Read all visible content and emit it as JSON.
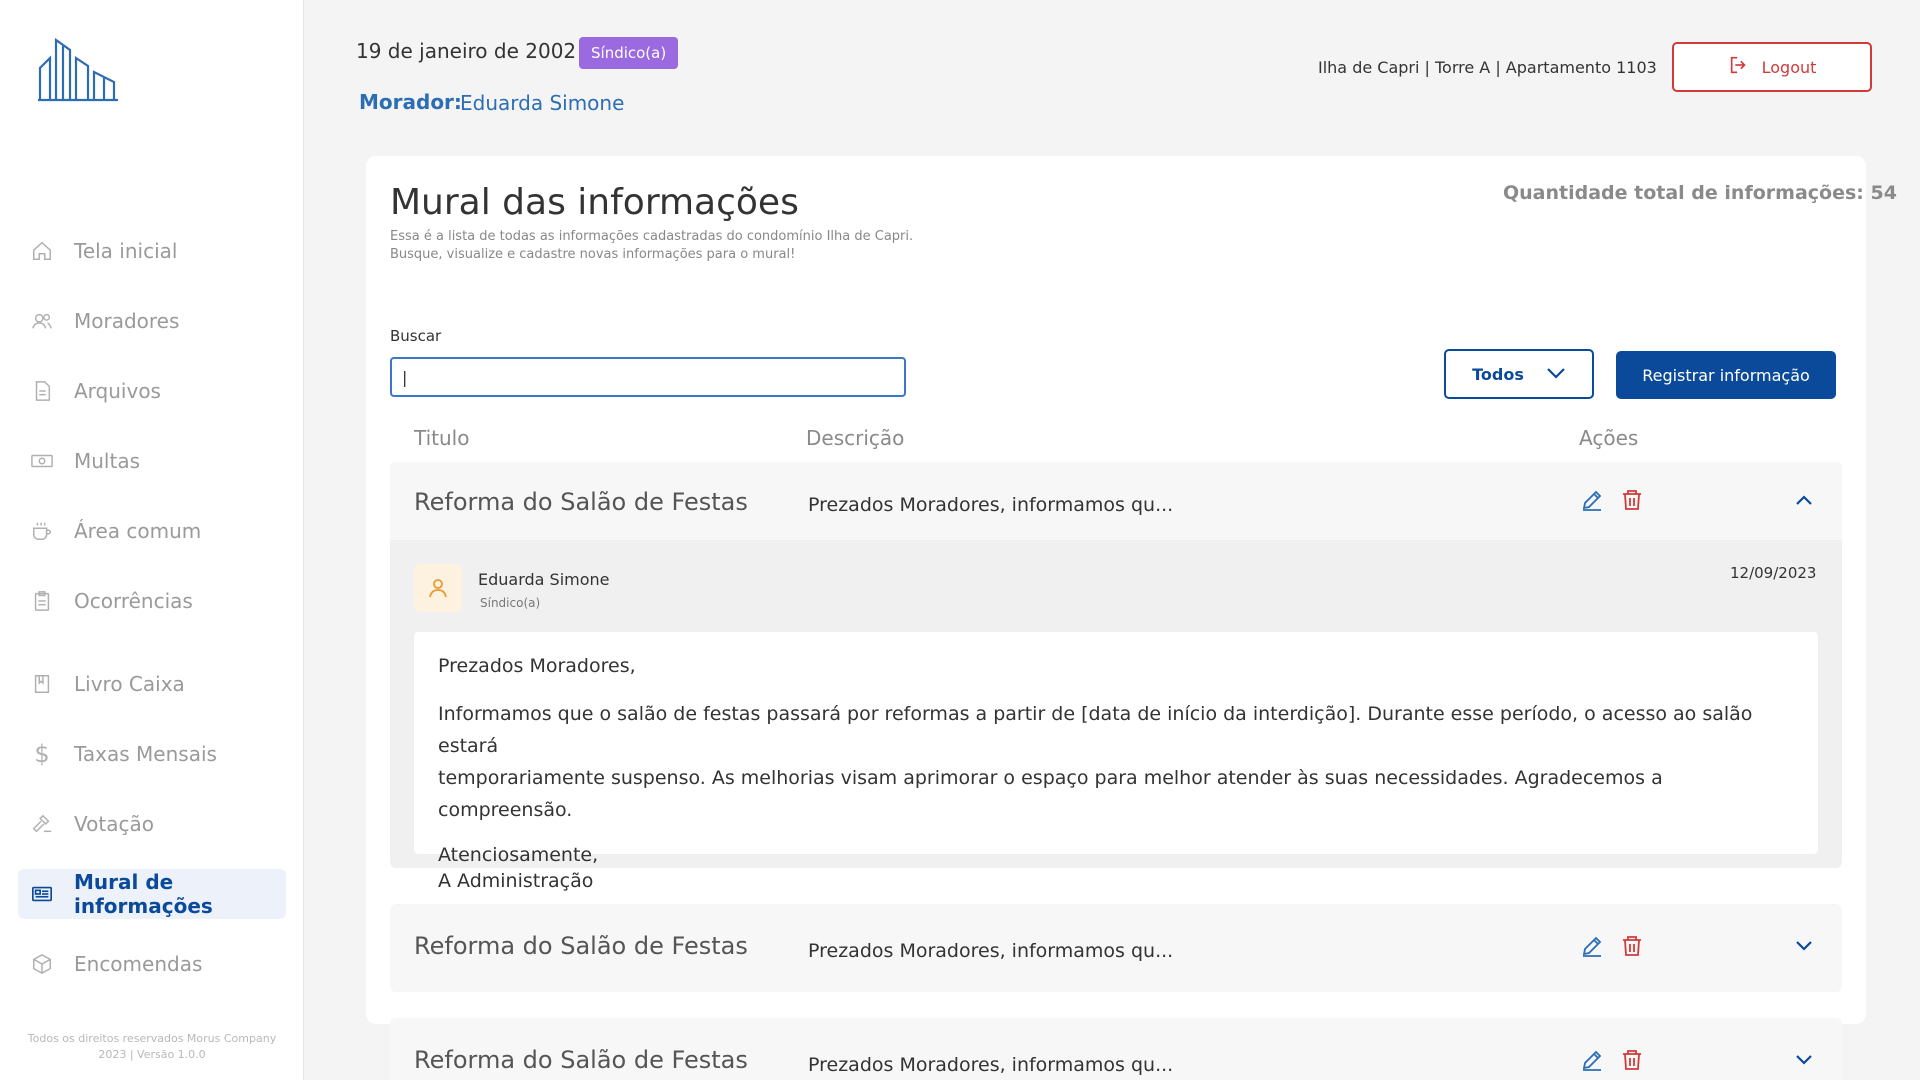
{
  "sidebar": {
    "items": [
      {
        "label": "Tela inicial",
        "icon": "home-icon"
      },
      {
        "label": "Moradores",
        "icon": "users-icon"
      },
      {
        "label": "Arquivos",
        "icon": "file-icon"
      },
      {
        "label": "Multas",
        "icon": "money-icon"
      },
      {
        "label": "Área comum",
        "icon": "coffee-icon"
      },
      {
        "label": "Ocorrências",
        "icon": "clipboard-icon"
      },
      {
        "label": "Livro Caixa",
        "icon": "book-icon"
      },
      {
        "label": "Taxas Mensais",
        "icon": "dollar-icon"
      },
      {
        "label": "Votação",
        "icon": "gavel-icon"
      },
      {
        "label": "Mural de informações",
        "icon": "newspaper-icon",
        "active": true
      },
      {
        "label": "Encomendas",
        "icon": "package-icon"
      }
    ],
    "footer_line1": "Todos os direitos reservados Morus Company",
    "footer_line2": "2023 | Versão 1.0.0"
  },
  "header": {
    "date": "19 de janeiro de 2002",
    "role_badge": "Síndico(a)",
    "morador_label": "Morador:",
    "morador_name": "Eduarda Simone",
    "unit_info": "Ilha de Capri | Torre A | Apartamento 1103",
    "logout_label": "Logout"
  },
  "main": {
    "title": "Mural das informações",
    "subtitle_line1": "Essa é a lista de todas as informações cadastradas do condomínio Ilha de Capri.",
    "subtitle_line2": "Busque, visualize e cadastre novas informações para o mural!",
    "total_label": "Quantidade total de informações: 54",
    "search_label": "Buscar",
    "search_value": "|",
    "filter_value": "Todos",
    "register_label": "Registrar informação",
    "columns": {
      "title": "Titulo",
      "description": "Descrição",
      "actions": "Ações"
    },
    "rows": [
      {
        "title": "Reforma do Salão de Festas",
        "description": "Prezados Moradores, informamos qu..."
      },
      {
        "title": "Reforma do Salão de Festas",
        "description": "Prezados Moradores, informamos qu..."
      },
      {
        "title": "Reforma do Salão de Festas",
        "description": "Prezados Moradores, informamos qu..."
      }
    ],
    "expanded": {
      "author_name": "Eduarda Simone",
      "author_role": "Síndico(a)",
      "date": "12/09/2023",
      "greeting": "Prezados Moradores,",
      "body_line1": "Informamos que o salão de festas passará por reformas a partir de [data de início da interdição]. Durante esse período, o acesso ao salão estará",
      "body_line2": "temporariamente suspenso. As melhorias visam aprimorar o espaço para melhor atender às suas necessidades. Agradecemos a compreensão.",
      "closing": "Atenciosamente,",
      "signature": "A Administração"
    }
  },
  "colors": {
    "primary": "#0b4a9a",
    "link": "#2d6db3",
    "badge": "#9b6ae0",
    "danger": "#d23a3a"
  }
}
